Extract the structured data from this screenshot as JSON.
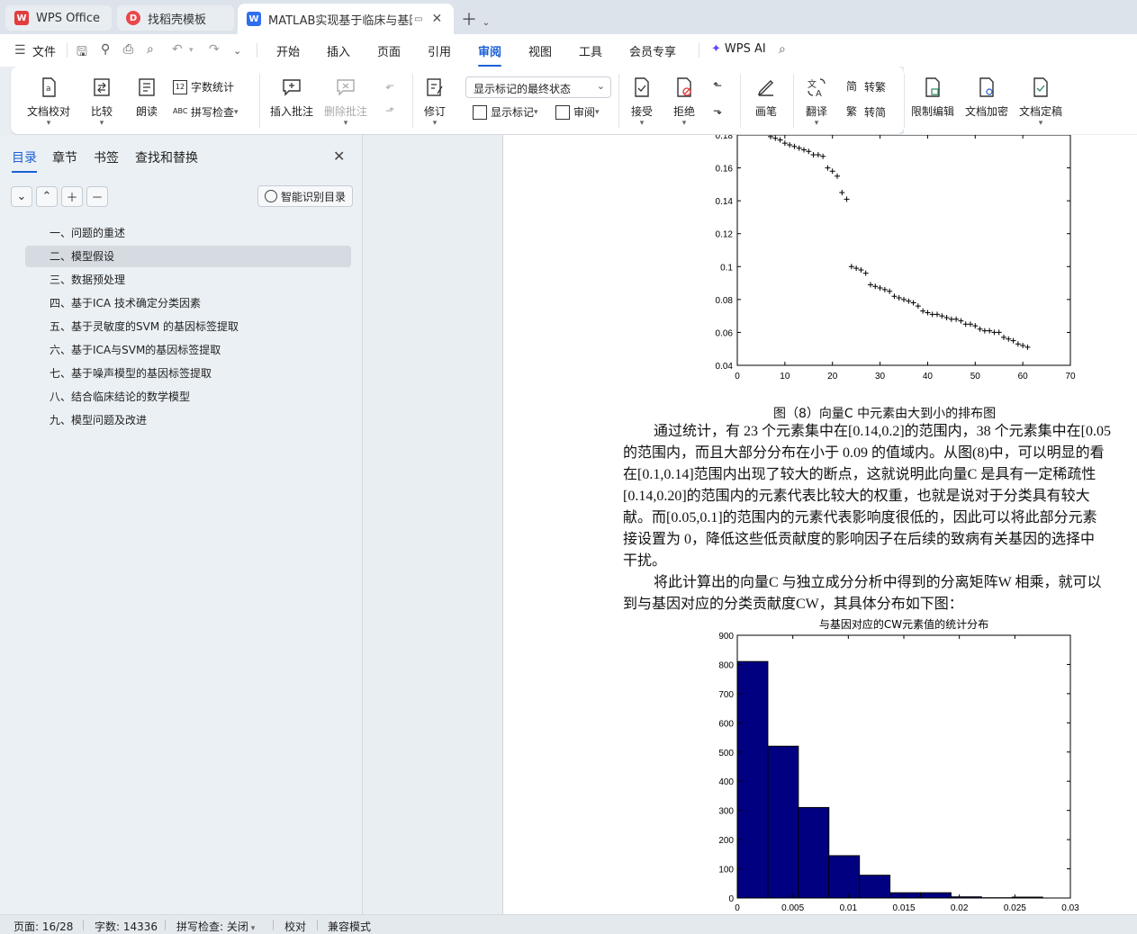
{
  "tabs": [
    {
      "label": "WPS Office",
      "icon": "wps-logo-icon"
    },
    {
      "label": "找稻壳模板",
      "icon": "docer-icon"
    },
    {
      "label": "MATLAB实现基于临床与基因",
      "icon": "writer-doc-icon"
    }
  ],
  "menubar": {
    "file": "文件",
    "items": [
      "开始",
      "插入",
      "页面",
      "引用",
      "审阅",
      "视图",
      "工具",
      "会员专享"
    ],
    "active": "审阅",
    "ai": "WPS AI"
  },
  "ribbon": {
    "doc_check": "文档校对",
    "compare": "比较",
    "read_aloud": "朗读",
    "word_count": "字数统计",
    "spell_check": "拼写检查",
    "insert_comment": "插入批注",
    "delete_comment": "删除批注",
    "revise": "修订",
    "markup_state": "显示标记的最终状态",
    "show_markup": "显示标记",
    "review": "审阅",
    "accept": "接受",
    "reject": "拒绝",
    "pen": "画笔",
    "translate": "翻译",
    "to_traditional": "转繁",
    "to_simplified": "转简",
    "restrict_edit": "限制编辑",
    "encrypt": "文档加密",
    "finalize": "文档定稿"
  },
  "nav": {
    "tabs": [
      "目录",
      "章节",
      "书签",
      "查找和替换"
    ],
    "smart_toc": "智能识别目录",
    "toc": [
      "一、问题的重述",
      "二、模型假设",
      "三、数据预处理",
      "四、基于ICA 技术确定分类因素",
      "五、基于灵敏度的SVM 的基因标签提取",
      "六、基于ICA与SVM的基因标签提取",
      "七、基于噪声模型的基因标签提取",
      "八、结合临床结论的数学模型",
      "九、模型问题及改进"
    ],
    "selected_index": 1
  },
  "doc": {
    "caption": "图（8）向量C 中元素由大到小的排布图",
    "p1": [
      "通过统计，有 23 个元素集中在[0.14,0.2]的范围内，38 个元素集中在[0.05",
      "的范围内，而且大部分分布在小于  0.09 的值域内。从图(8)中，可以明显的看",
      "在[0.1,0.14]范围内出现了较大的断点，这就说明此向量C 是具有一定稀疏性",
      "[0.14,0.20]的范围内的元素代表比较大的权重，也就是说对于分类具有较大",
      "献。而[0.05,0.1]的范围内的元素代表影响度很低的，因此可以将此部分元素",
      "接设置为 0，降低这些低贡献度的影响因子在后续的致病有关基因的选择中",
      "干扰。"
    ],
    "p2": [
      "将此计算出的向量C 与独立成分分析中得到的分离矩阵W 相乘，就可以",
      "到与基因对应的分类贡献度CW，其具体分布如下图："
    ]
  },
  "chart_data": [
    {
      "type": "scatter",
      "marker": "+",
      "title": "",
      "xlim": [
        0,
        70
      ],
      "ylim": [
        0.04,
        0.18
      ],
      "xticks": [
        0,
        10,
        20,
        30,
        40,
        50,
        60,
        70
      ],
      "yticks": [
        "0.04",
        "0.06",
        "0.08",
        "0.1",
        "0.12",
        "0.14",
        "0.16",
        "0.18"
      ],
      "x": [
        7,
        8,
        9,
        10,
        11,
        12,
        13,
        14,
        15,
        16,
        17,
        18,
        19,
        20,
        21,
        22,
        23,
        24,
        25,
        26,
        27,
        28,
        29,
        30,
        31,
        32,
        33,
        34,
        35,
        36,
        37,
        38,
        39,
        40,
        41,
        42,
        43,
        44,
        45,
        46,
        47,
        48,
        49,
        50,
        51,
        52,
        53,
        54,
        55,
        56,
        57,
        58,
        59,
        60,
        61
      ],
      "y": [
        0.179,
        0.178,
        0.177,
        0.175,
        0.174,
        0.173,
        0.172,
        0.171,
        0.17,
        0.168,
        0.168,
        0.167,
        0.16,
        0.158,
        0.155,
        0.145,
        0.141,
        0.1,
        0.099,
        0.098,
        0.096,
        0.089,
        0.088,
        0.087,
        0.086,
        0.085,
        0.082,
        0.081,
        0.08,
        0.079,
        0.078,
        0.076,
        0.073,
        0.072,
        0.071,
        0.071,
        0.07,
        0.069,
        0.068,
        0.068,
        0.067,
        0.065,
        0.065,
        0.064,
        0.062,
        0.061,
        0.061,
        0.06,
        0.06,
        0.057,
        0.056,
        0.055,
        0.053,
        0.052,
        0.051
      ]
    },
    {
      "type": "bar",
      "title": "与基因对应的CW元素值的统计分布",
      "bar_color": "#000080",
      "xlim": [
        0,
        0.03
      ],
      "ylim": [
        0,
        900
      ],
      "xticks": [
        "0",
        "0.005",
        "0.01",
        "0.015",
        "0.02",
        "0.025",
        "0.03"
      ],
      "yticks": [
        "0",
        "100",
        "200",
        "300",
        "400",
        "500",
        "600",
        "700",
        "800",
        "900"
      ],
      "bins": [
        [
          0,
          0.00275
        ],
        [
          0.00275,
          0.0055
        ],
        [
          0.0055,
          0.00825
        ],
        [
          0.00825,
          0.011
        ],
        [
          0.011,
          0.01375
        ],
        [
          0.01375,
          0.0165
        ],
        [
          0.0165,
          0.01925
        ],
        [
          0.01925,
          0.022
        ],
        [
          0.022,
          0.02475
        ],
        [
          0.02475,
          0.0275
        ]
      ],
      "values": [
        810,
        520,
        310,
        145,
        78,
        18,
        18,
        4,
        1,
        3
      ]
    }
  ],
  "status": {
    "page": "页面: 16/28",
    "words": "字数: 14336",
    "spell": "拼写检查: 关闭",
    "proof": "校对",
    "compat": "兼容模式"
  }
}
